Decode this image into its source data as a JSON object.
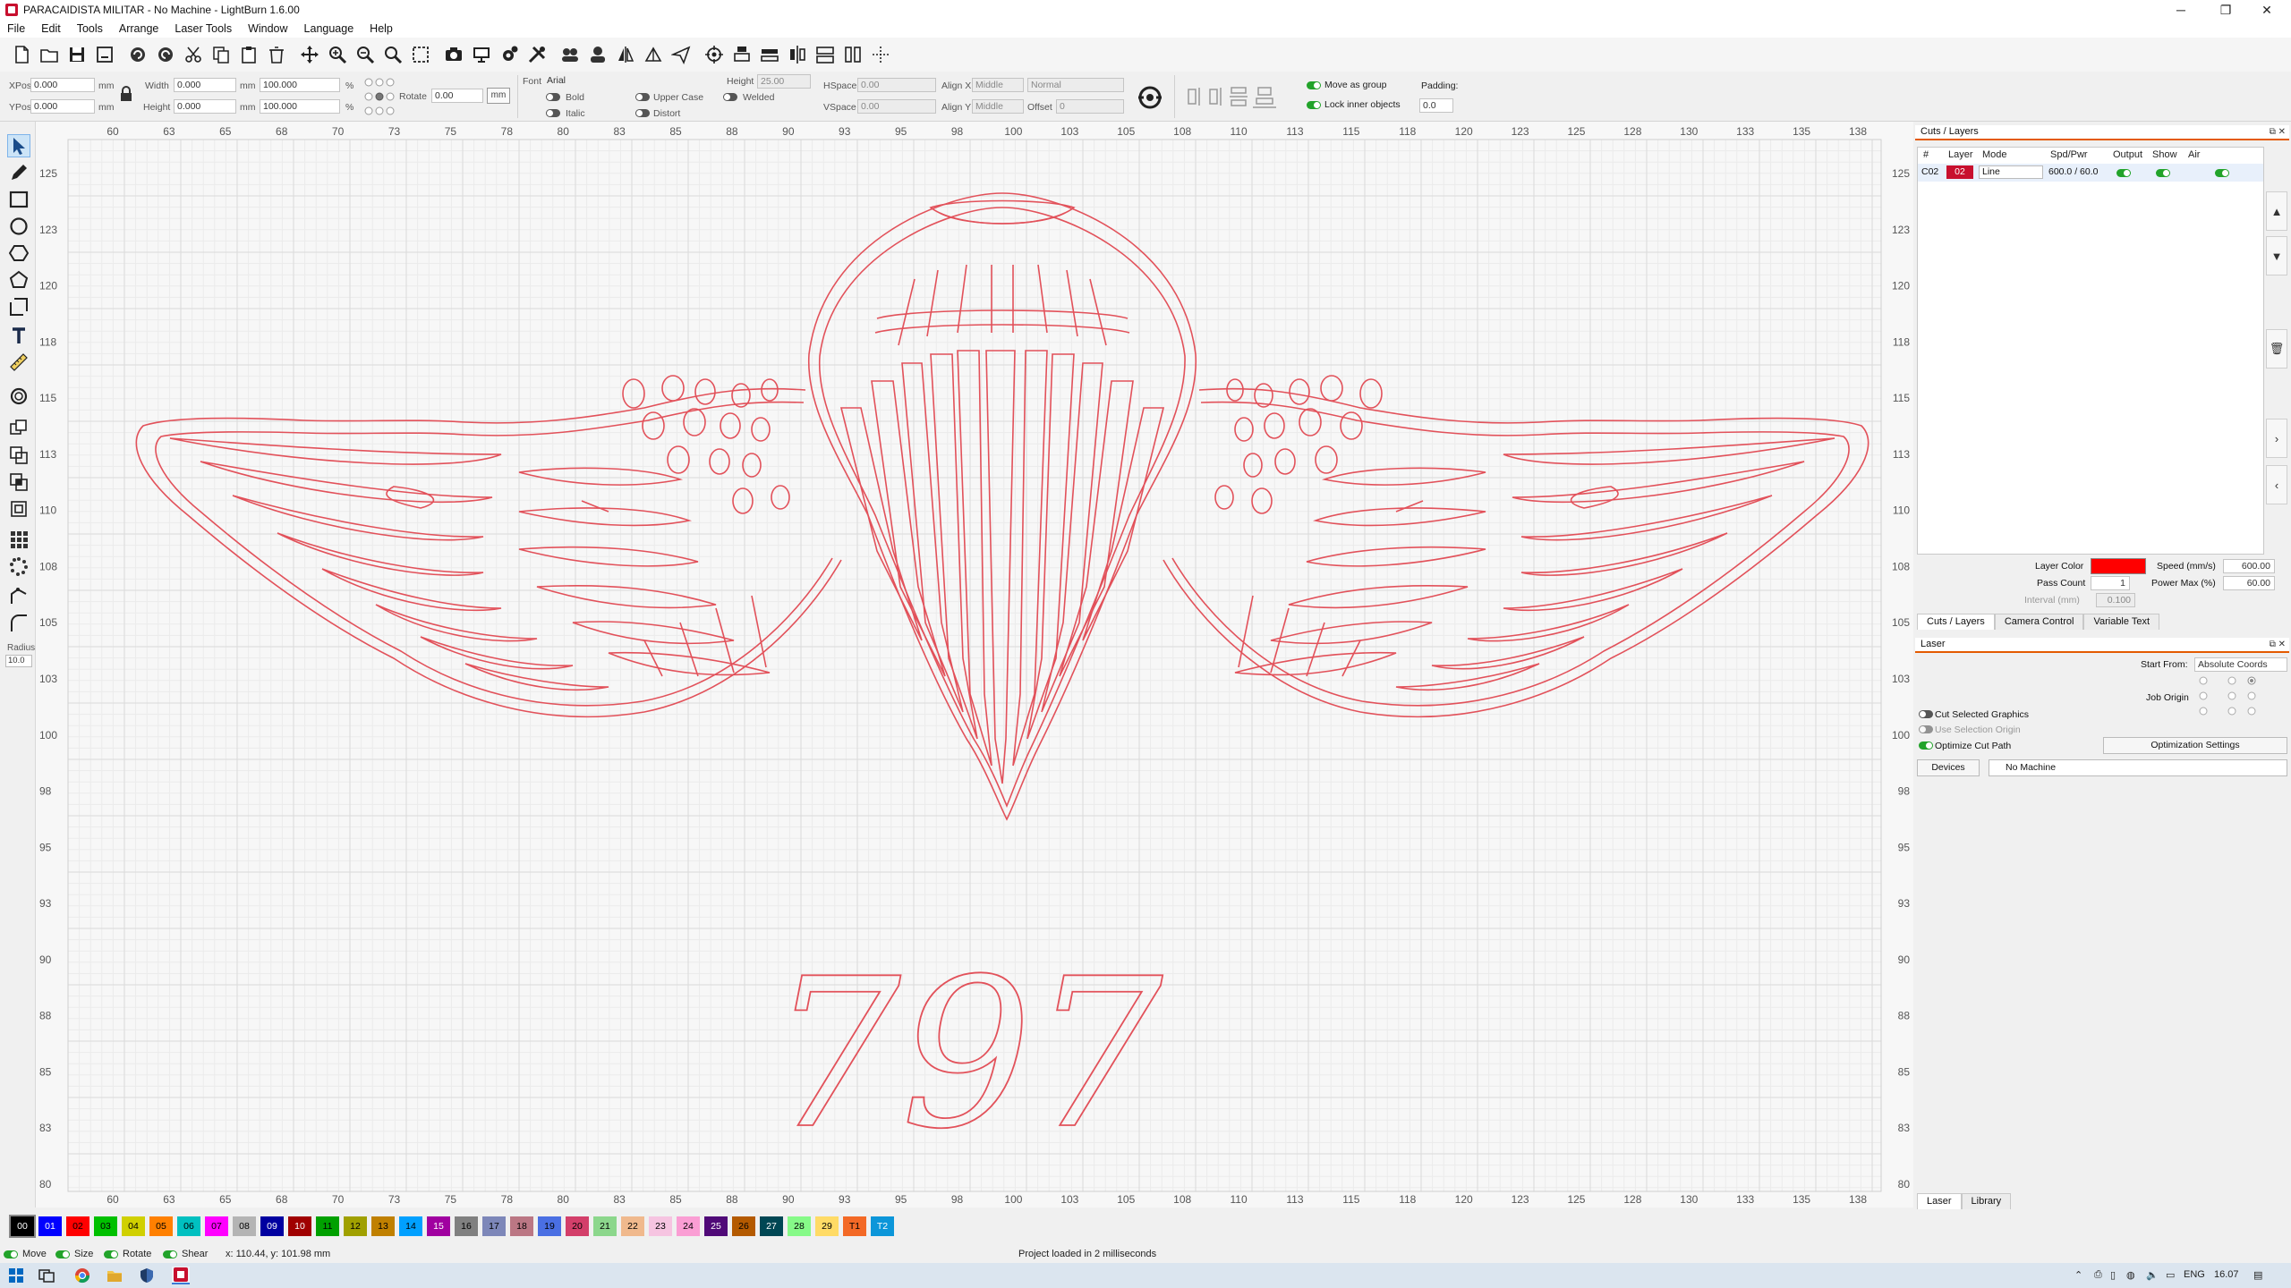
{
  "window": {
    "title": "PARACAIDISTA MILITAR - No Machine - LightBurn 1.6.00",
    "minimize": "─",
    "maximize": "❐",
    "close": "✕"
  },
  "menu": [
    "File",
    "Edit",
    "Tools",
    "Arrange",
    "Laser Tools",
    "Window",
    "Language",
    "Help"
  ],
  "toolbar_icons": [
    "new-file-icon",
    "open-folder-icon",
    "save-icon",
    "save-as-icon",
    "undo-icon",
    "redo-icon",
    "cut-icon",
    "copy-icon",
    "paste-icon",
    "delete-icon",
    "move-icon",
    "zoom-in-icon",
    "zoom-out-icon",
    "zoom-fit-icon",
    "select-rect-icon",
    "camera-icon",
    "monitor-icon",
    "settings-icon",
    "tools-icon",
    "group-icon",
    "user-icon",
    "flip-horizontal-icon",
    "mirror-icon",
    "send-icon",
    "target-icon",
    "align-icon",
    "distribute-icon",
    "align-vertical-icon",
    "dock-icon",
    "space-icon",
    "plus-icon"
  ],
  "props": {
    "xpos_label": "XPos",
    "xpos": "0.000",
    "ypos_label": "YPos",
    "ypos": "0.000",
    "unit": "mm",
    "width_label": "Width",
    "width": "0.000",
    "height_label": "Height",
    "height": "0.000",
    "scale_w": "100.000",
    "scale_h": "100.000",
    "percent": "%",
    "rotate_label": "Rotate",
    "rotate": "0.00",
    "font_label": "Font",
    "font": "Arial",
    "font_height_label": "Height",
    "font_height": "25.00",
    "hspace_label": "HSpace",
    "hspace": "0.00",
    "vspace_label": "VSpace",
    "vspace": "0.00",
    "alignx_label": "Align X",
    "alignx": "Middle",
    "aligny_label": "Align Y",
    "aligny": "Middle",
    "normal": "Normal",
    "offset_label": "Offset",
    "offset": "0",
    "bold": "Bold",
    "italic": "Italic",
    "upper": "Upper Case",
    "distort": "Distort",
    "welded": "Welded",
    "move_group": "Move as group",
    "lock_inner": "Lock inner objects",
    "padding_label": "Padding:",
    "padding": "0.0"
  },
  "left_tools": [
    "select-arrow-icon",
    "pen-icon",
    "rectangle-icon",
    "ellipse-icon",
    "polygon-icon",
    "pentagon-icon",
    "frame-icon",
    "text-icon",
    "measure-icon",
    "offset-icon",
    "boolean-union-icon",
    "boolean-subtract-icon",
    "boolean-intersect-icon",
    "weld-icon",
    "grid-array-icon",
    "circular-array-icon",
    "path-edit-icon",
    "corner-icon"
  ],
  "radius": {
    "label": "Radius:",
    "value": "10.0"
  },
  "ruler": {
    "x_labels": [
      "60",
      "63",
      "65",
      "68",
      "70",
      "73",
      "75",
      "78",
      "80",
      "83",
      "85",
      "88",
      "90",
      "93",
      "95",
      "98",
      "100",
      "103",
      "105",
      "108",
      "110",
      "113",
      "115",
      "118",
      "120",
      "123",
      "125",
      "128",
      "130",
      "133",
      "135",
      "138"
    ],
    "y_labels": [
      "125",
      "123",
      "120",
      "118",
      "115",
      "113",
      "110",
      "108",
      "105",
      "103",
      "100",
      "98",
      "95",
      "93",
      "90",
      "88",
      "85",
      "83",
      "80"
    ]
  },
  "design": {
    "text": "797",
    "color": "#e2515a"
  },
  "layers_panel": {
    "title": "Cuts / Layers",
    "headers": [
      "#",
      "Layer",
      "Mode",
      "Spd/Pwr",
      "Output",
      "Show",
      "Air"
    ],
    "rows": [
      {
        "num": "C02",
        "layer": "02",
        "mode": "Line",
        "spdpwr": "600.0 / 60.0",
        "color": "#c8102e"
      }
    ],
    "layer_color_label": "Layer Color",
    "layer_color": "#ff0000",
    "speed_label": "Speed (mm/s)",
    "speed": "600.00",
    "pass_label": "Pass Count",
    "pass": "1",
    "power_label": "Power Max (%)",
    "power": "60.00",
    "interval_label": "Interval (mm)",
    "interval": "0.100",
    "tabs": [
      "Cuts / Layers",
      "Camera Control",
      "Variable Text"
    ]
  },
  "laser_panel": {
    "title": "Laser",
    "start_from_label": "Start From:",
    "start_from": "Absolute Coords",
    "job_origin_label": "Job Origin",
    "cut_selected": "Cut Selected Graphics",
    "use_selection": "Use Selection Origin",
    "optimize": "Optimize Cut Path",
    "opt_settings": "Optimization Settings",
    "devices": "Devices",
    "machine": "No Machine",
    "tabs": [
      "Laser",
      "Library"
    ]
  },
  "palette": [
    {
      "label": "00",
      "color": "#000000",
      "text": "#ffffff"
    },
    {
      "label": "01",
      "color": "#0000ff",
      "text": "#ffffff"
    },
    {
      "label": "02",
      "color": "#ff0000",
      "text": "#000000"
    },
    {
      "label": "03",
      "color": "#00c000",
      "text": "#000000"
    },
    {
      "label": "04",
      "color": "#d0d000",
      "text": "#000000"
    },
    {
      "label": "05",
      "color": "#ff8000",
      "text": "#000000"
    },
    {
      "label": "06",
      "color": "#00c0c0",
      "text": "#000000"
    },
    {
      "label": "07",
      "color": "#ff00ff",
      "text": "#000000"
    },
    {
      "label": "08",
      "color": "#b4b4b4",
      "text": "#000000"
    },
    {
      "label": "09",
      "color": "#0000a0",
      "text": "#ffffff"
    },
    {
      "label": "10",
      "color": "#a00000",
      "text": "#ffffff"
    },
    {
      "label": "11",
      "color": "#00a000",
      "text": "#000000"
    },
    {
      "label": "12",
      "color": "#a0a000",
      "text": "#000000"
    },
    {
      "label": "13",
      "color": "#c08000",
      "text": "#000000"
    },
    {
      "label": "14",
      "color": "#00a0ff",
      "text": "#000000"
    },
    {
      "label": "15",
      "color": "#a000a0",
      "text": "#ffffff"
    },
    {
      "label": "16",
      "color": "#808080",
      "text": "#000000"
    },
    {
      "label": "17",
      "color": "#7d87b9",
      "text": "#000000"
    },
    {
      "label": "18",
      "color": "#bb7784",
      "text": "#000000"
    },
    {
      "label": "19",
      "color": "#4a6fe3",
      "text": "#000000"
    },
    {
      "label": "20",
      "color": "#d33f6a",
      "text": "#000000"
    },
    {
      "label": "21",
      "color": "#8cd78c",
      "text": "#000000"
    },
    {
      "label": "22",
      "color": "#f0b98d",
      "text": "#000000"
    },
    {
      "label": "23",
      "color": "#f6c4e1",
      "text": "#000000"
    },
    {
      "label": "24",
      "color": "#fa9ed4",
      "text": "#000000"
    },
    {
      "label": "25",
      "color": "#500a78",
      "text": "#ffffff"
    },
    {
      "label": "26",
      "color": "#b45a00",
      "text": "#000000"
    },
    {
      "label": "27",
      "color": "#004754",
      "text": "#ffffff"
    },
    {
      "label": "28",
      "color": "#86fa88",
      "text": "#000000"
    },
    {
      "label": "29",
      "color": "#ffdb66",
      "text": "#000000"
    },
    {
      "label": "T1",
      "color": "#f36926",
      "text": "#000000"
    },
    {
      "label": "T2",
      "color": "#0c96d9",
      "text": "#ffffff"
    }
  ],
  "status": {
    "move": "Move",
    "size": "Size",
    "rotate": "Rotate",
    "shear": "Shear",
    "coords": "x: 110.44, y: 101.98 mm",
    "message": "Project loaded in 2 milliseconds"
  },
  "taskbar": {
    "lang": "ENG",
    "time": "16.07"
  }
}
